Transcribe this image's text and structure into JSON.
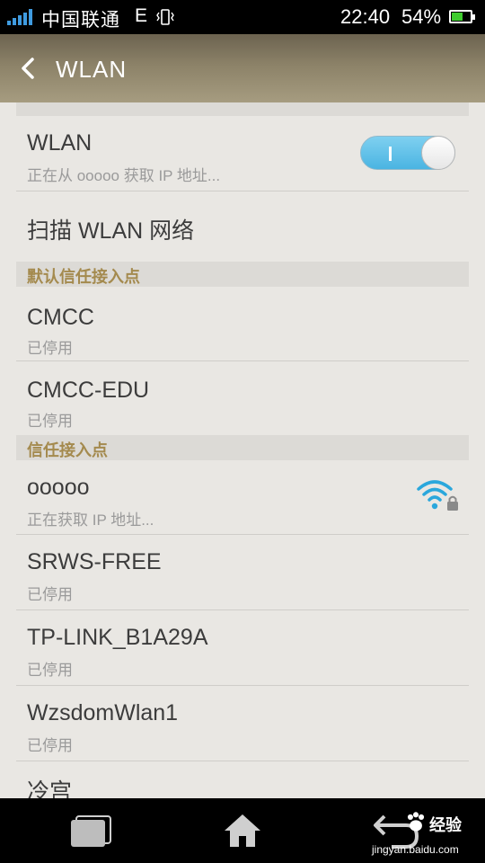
{
  "status_bar": {
    "carrier": "中国联通",
    "network": "E",
    "time": "22:40",
    "battery_percent": "54%",
    "battery_level": 0.54,
    "signal_color": "#3f9be0",
    "battery_color": "#3fcc2f"
  },
  "header": {
    "title": "WLAN",
    "back_icon": "chevron-left-icon"
  },
  "wlan_toggle": {
    "label": "WLAN",
    "status": "正在从 ooooo 获取 IP 地址...",
    "on_mark": "I",
    "enabled": true,
    "accent_color": "#4ab4e2"
  },
  "scan": {
    "label": "扫描 WLAN 网络"
  },
  "sections": {
    "default_trusted": {
      "header": "默认信任接入点",
      "items": [
        {
          "name": "CMCC",
          "status": "已停用"
        },
        {
          "name": "CMCC-EDU",
          "status": "已停用"
        }
      ]
    },
    "trusted": {
      "header": "信任接入点",
      "items": [
        {
          "name": "ooooo",
          "status": "正在获取 IP 地址...",
          "icon": "wifi-locked-icon"
        },
        {
          "name": "SRWS-FREE",
          "status": "已停用"
        },
        {
          "name": "TP-LINK_B1A29A",
          "status": "已停用"
        },
        {
          "name": "WzsdomWlan1",
          "status": "已停用"
        },
        {
          "name": "冷宫",
          "status": ""
        }
      ]
    }
  },
  "watermark": {
    "brand": "Baidu",
    "product": "经验",
    "url": "jingyan.baidu.com"
  }
}
